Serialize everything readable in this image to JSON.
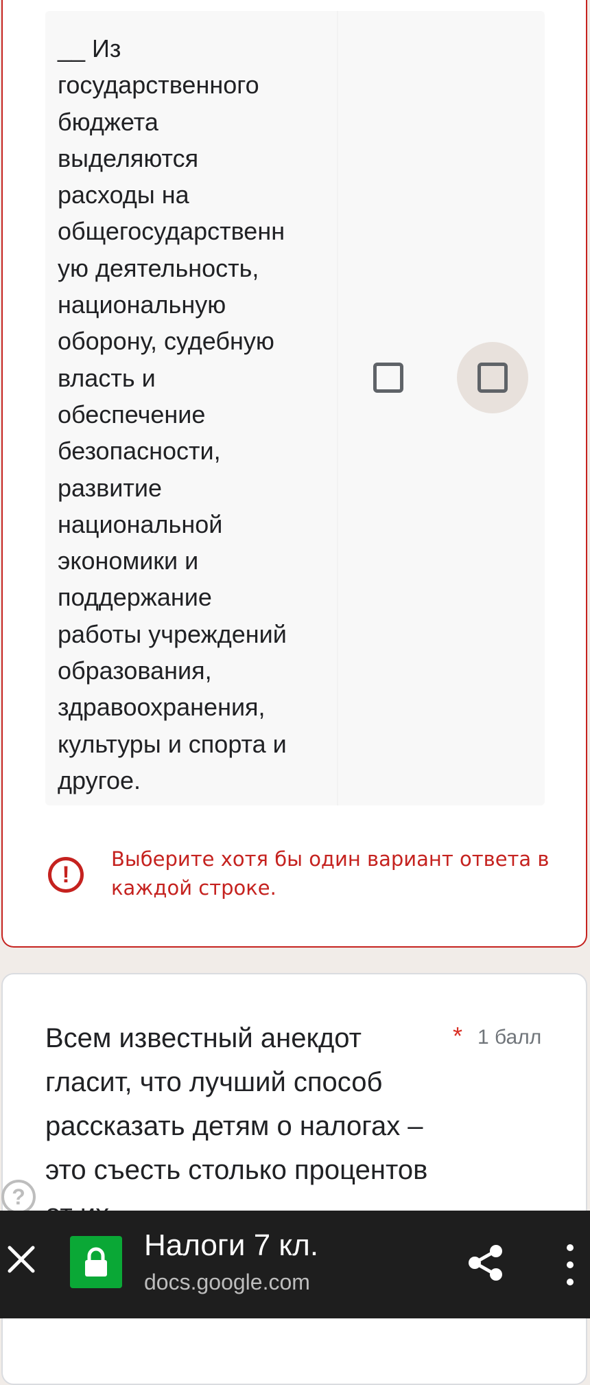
{
  "grid": {
    "row_label": "__ Из\nгосударственного\nбюджета\nвыделяются\nрасходы на\nобщегосударственн\nую деятельность,\nнациональную\nоборону, судебную\nвласть и\nобеспечение\nбезопасности,\nразвитие\nнациональной\nэкономики и\nподдержание\nработы учреждений\nобразования,\nздравоохранения,\nкультуры и спорта и\nдругое."
  },
  "error": {
    "icon": "error-icon",
    "icon_glyph": "!",
    "message": "Выберите хотя бы один вариант ответа в каждой строке."
  },
  "question": {
    "text": "Всем известный анекдот гласит, что лучший способ рассказать детям о налогах – это съесть столько процентов от их",
    "required_mark": "*",
    "points": "1 балл"
  },
  "help": {
    "glyph": "?"
  },
  "browser_bar": {
    "title": "Налоги 7 кл.",
    "url": "docs.google.com",
    "lock_color": "#0aa836",
    "close_icon": "close-icon",
    "share_icon": "share-icon",
    "menu_icon": "more-vert-icon"
  },
  "colors": {
    "error": "#c5221f",
    "background": "#f1ece8"
  }
}
